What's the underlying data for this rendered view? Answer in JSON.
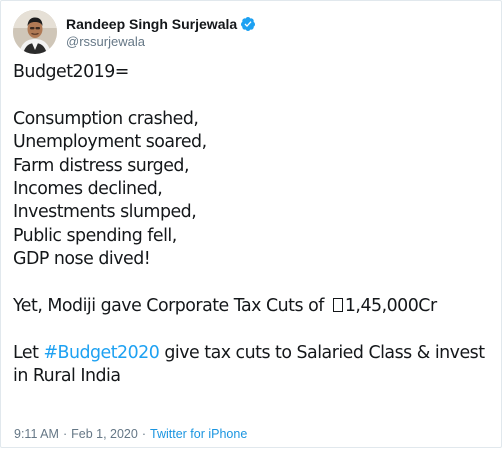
{
  "author": {
    "display_name": "Randeep Singh Surjewala",
    "handle": "@rssurjewala",
    "verified": true,
    "avatar_icon": "profile-photo"
  },
  "tweet": {
    "lines": [
      "Budget2019=",
      "",
      "Consumption crashed,",
      "Unemployment soared,",
      "Farm distress surged,",
      "Incomes declined,",
      "Investments slumped,",
      "Public spending fell,",
      "GDP nose dived!",
      "",
      "Yet, Modiji gave Corporate Tax Cuts of ",
      "1,45,000Cr",
      "",
      "Let ",
      "#Budget2020",
      " give tax cuts to Salaried Class & invest",
      "in Rural India"
    ]
  },
  "meta": {
    "time": "9:11 AM",
    "separator": "·",
    "date": "Feb 1, 2020",
    "source": "Twitter for iPhone"
  },
  "colors": {
    "link": "#1da1f2",
    "verified_badge": "#1da1f2",
    "muted": "#657786",
    "text": "#14171a"
  }
}
